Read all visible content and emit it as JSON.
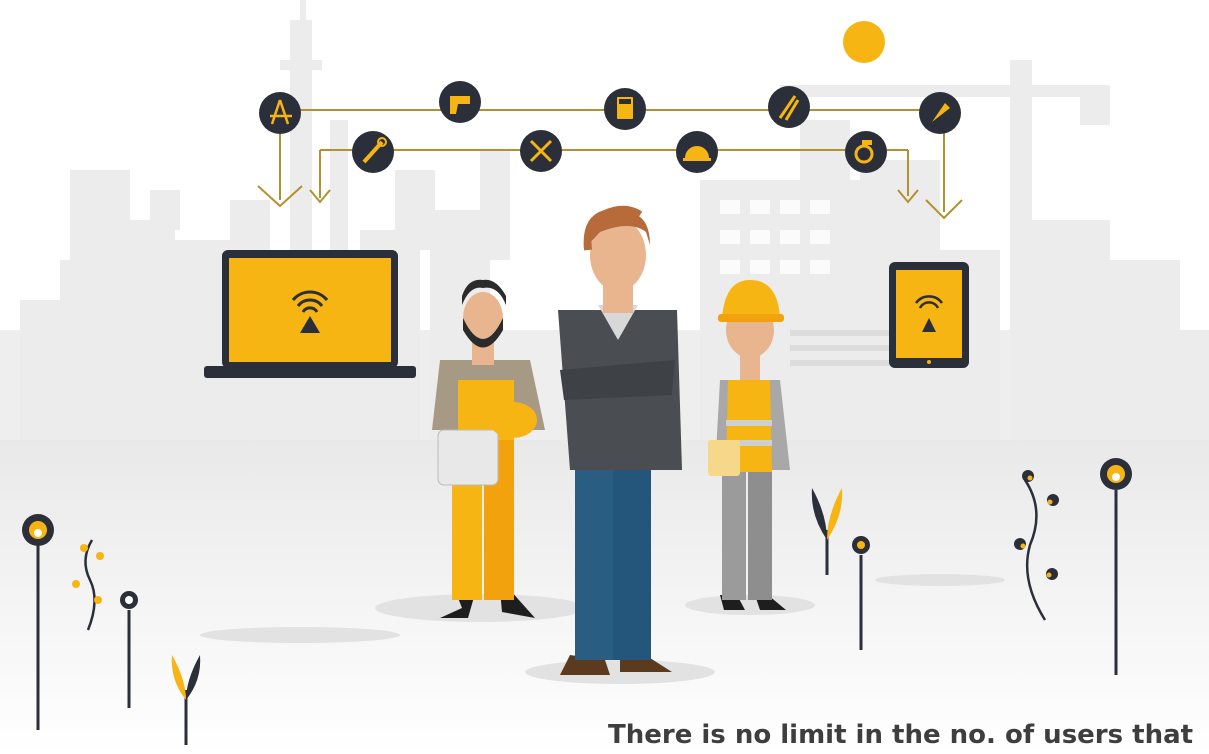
{
  "caption": "There is no limit in the no. of users that",
  "colors": {
    "accent": "#f7b514",
    "dark": "#2b2f3a",
    "line": "#b5902f",
    "skyline": "#ececec",
    "ground": "#f2f2f2"
  },
  "tool_icons": [
    "compass-icon",
    "drill-icon",
    "calculator-icon",
    "pliers-icon",
    "trowel-icon",
    "wrench-icon",
    "hammer-wrench-icon",
    "saw-blade-icon",
    "tape-measure-icon"
  ],
  "devices": [
    "laptop",
    "tablet"
  ],
  "people": [
    "bearded-worker",
    "businessman",
    "hardhat-worker"
  ]
}
